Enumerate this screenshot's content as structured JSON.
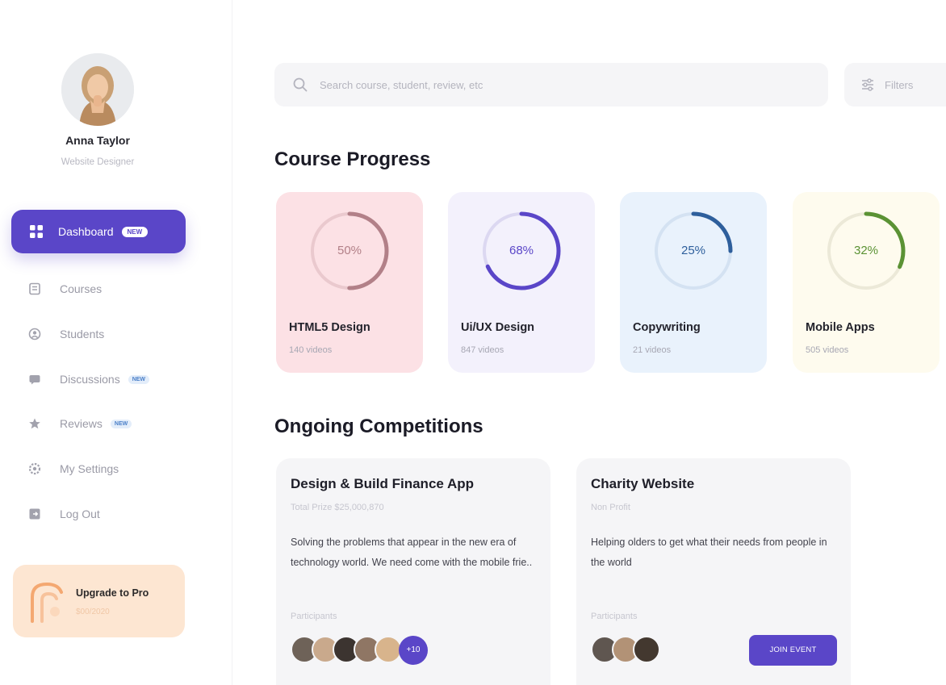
{
  "profile": {
    "name": "Anna Taylor",
    "role": "Website Designer"
  },
  "sidebar": {
    "active": {
      "label": "Dashboard",
      "badge": "NEW"
    },
    "items": [
      {
        "label": "Courses",
        "icon": "book-icon",
        "badge": ""
      },
      {
        "label": "Students",
        "icon": "user-icon",
        "badge": ""
      },
      {
        "label": "Discussions",
        "icon": "chat-icon",
        "badge": "NEW"
      },
      {
        "label": "Reviews",
        "icon": "star-icon",
        "badge": "NEW"
      },
      {
        "label": "My Settings",
        "icon": "gear-icon",
        "badge": ""
      },
      {
        "label": "Log Out",
        "icon": "logout-icon",
        "badge": ""
      }
    ],
    "upgrade": {
      "title": "Upgrade to Pro",
      "subtitle": "$00/2020"
    }
  },
  "search": {
    "placeholder": "Search course, student, review, etc"
  },
  "filters": {
    "label": "Filters"
  },
  "course_progress": {
    "title": "Course Progress",
    "cards": [
      {
        "title": "HTML5 Design",
        "subtitle": "140 videos",
        "percent": 50,
        "percent_label": "50%",
        "bg": "#fce1e5",
        "ring": "#b28088",
        "track": "#eac9ce",
        "text_color": "#b28088"
      },
      {
        "title": "Ui/UX Design",
        "subtitle": "847 videos",
        "percent": 68,
        "percent_label": "68%",
        "bg": "#f3f1fc",
        "ring": "#5a46c8",
        "track": "#dcd8f1",
        "text_color": "#5a46c8"
      },
      {
        "title": "Copywriting",
        "subtitle": "21 videos",
        "percent": 25,
        "percent_label": "25%",
        "bg": "#e9f2fc",
        "ring": "#2e5f9c",
        "track": "#d4e2f2",
        "text_color": "#2e5f9c"
      },
      {
        "title": "Mobile Apps",
        "subtitle": "505 videos",
        "percent": 32,
        "percent_label": "32%",
        "bg": "#fefbee",
        "ring": "#5b9234",
        "track": "#ece9d8",
        "text_color": "#5b9234"
      }
    ]
  },
  "competitions": {
    "title": "Ongoing Competitions",
    "cards": [
      {
        "title": "Design & Build Finance App",
        "subtitle": "Total Prize $25,000,870",
        "description": "Solving the problems that appear in the new era of technology world. We need come with the mobile frie..",
        "participants_label": "Participants",
        "more_label": "+10"
      },
      {
        "title": "Charity Website",
        "subtitle": "Non Profit",
        "description": "Helping olders to get what their needs from people in the world",
        "participants_label": "Participants",
        "button_label": "JOIN EVENT"
      }
    ]
  },
  "colors": {
    "accent": "#5a46c8",
    "upgrade_bg": "#fde6d2",
    "card_bg": "#f5f5f7"
  }
}
